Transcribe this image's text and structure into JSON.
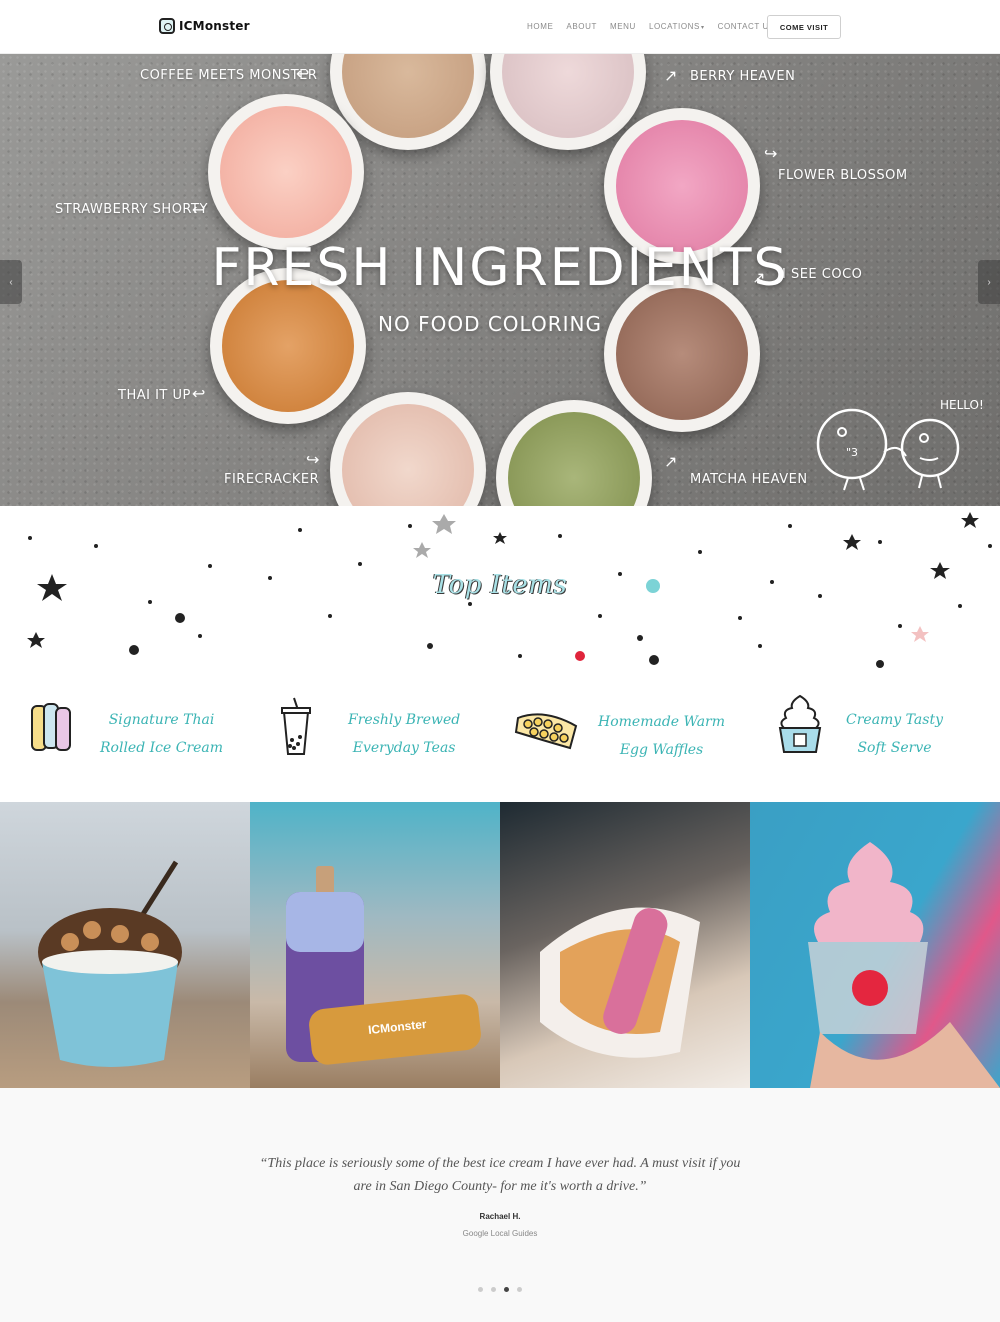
{
  "header": {
    "logo_text": "ICMonster",
    "nav": [
      {
        "label": "HOME"
      },
      {
        "label": "ABOUT"
      },
      {
        "label": "MENU"
      },
      {
        "label": "LOCATIONS",
        "has_dropdown": true
      },
      {
        "label": "CONTACT US"
      }
    ],
    "cta_label": "COME VISIT"
  },
  "hero": {
    "title": "FRESH INGREDIENTS",
    "subtitle": "NO FOOD COLORING",
    "flavors": [
      "COFFEE MEETS MONSTER",
      "BERRY HEAVEN",
      "FLOWER BLOSSOM",
      "STRAWBERRY SHORTY",
      "I SEE COCO",
      "THAI IT UP",
      "FIRECRACKER",
      "MATCHA HEAVEN"
    ],
    "hello_text": "HELLO!",
    "prev_arrow": "‹",
    "next_arrow": "›"
  },
  "top_items": {
    "title": "Top Items"
  },
  "features": [
    {
      "line1": "Signature Thai",
      "line2": "Rolled Ice Cream",
      "icon": "ice-cream-roll-icon"
    },
    {
      "line1": "Freshly Brewed",
      "line2": "Everyday Teas",
      "icon": "boba-tea-icon"
    },
    {
      "line1": "Homemade Warm",
      "line2": "Egg Waffles",
      "icon": "egg-waffle-icon"
    },
    {
      "line1": "Creamy Tasty",
      "line2": "Soft Serve",
      "icon": "soft-serve-icon"
    }
  ],
  "bottle_label": "ICMonster",
  "testimonial": {
    "quote": "“This place is seriously some of the best ice cream I have ever had. A must visit if you are in San Diego County- for me it's worth a drive.”",
    "author": "Rachael H.",
    "role": "Google Local Guides",
    "dot_count": 4,
    "active_dot": 3
  },
  "colors": {
    "accent_teal": "#3bb4b4",
    "top_items_teal": "#a9e1e6"
  }
}
